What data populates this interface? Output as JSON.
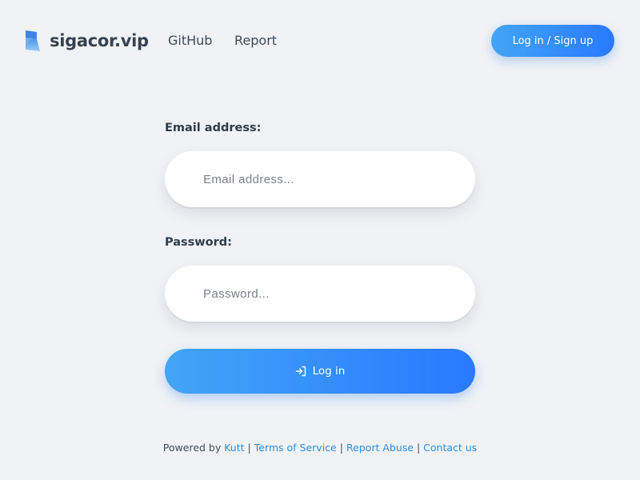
{
  "header": {
    "logo_text": "sigacor.vip",
    "nav": {
      "github": "GitHub",
      "report": "Report"
    },
    "auth_button": "Log in / Sign up"
  },
  "form": {
    "email": {
      "label": "Email address:",
      "placeholder": "Email address..."
    },
    "password": {
      "label": "Password:",
      "placeholder": "Password..."
    },
    "login_button": "Log in"
  },
  "footer": {
    "powered_by": "Powered by",
    "kutt": "Kutt",
    "terms": "Terms of Service",
    "report_abuse": "Report Abuse",
    "contact": "Contact us",
    "separator": "|"
  },
  "icons": {
    "logo": "logo-mark-icon",
    "login": "login-arrow-icon"
  },
  "colors": {
    "accent_start": "#42a5f5",
    "accent_end": "#2979ff",
    "background": "#f0f2f5",
    "link": "#2f8ee0"
  }
}
